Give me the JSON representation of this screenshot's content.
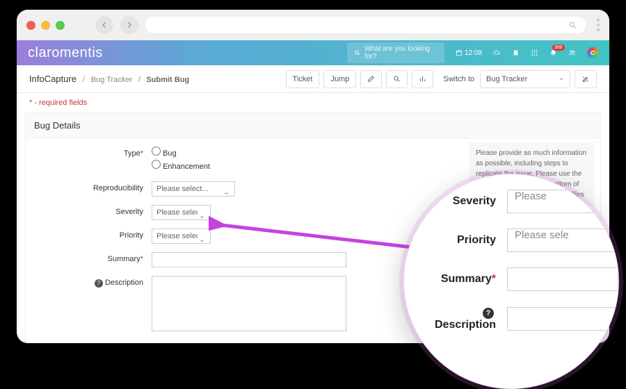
{
  "chrome": {
    "dot_colors": [
      "#ec5f57",
      "#f6bd3b",
      "#5dc94e"
    ]
  },
  "header": {
    "brand": "claromentis",
    "search_placeholder": "What are you looking for?",
    "time": "12:08",
    "badge": "368"
  },
  "breadcrumb": {
    "root": "InfoCapture",
    "mid": "Bug Tracker",
    "leaf": "Submit Bug",
    "ticket": "Ticket",
    "jump": "Jump",
    "switch": "Switch to",
    "switch_value": "Bug Tracker"
  },
  "required_note": "* - required fields",
  "panel": {
    "title": "Bug Details",
    "tip": "Please provide as much information as possible, including steps to replicate the issue. Please use the file upload facility at the bottom of the form to attach any relevant files"
  },
  "form": {
    "type_label": "Type",
    "type_opts": [
      "Bug",
      "Enhancement"
    ],
    "repro_label": "Reproducibility",
    "severity_label": "Severity",
    "priority_label": "Priority",
    "summary_label": "Summary",
    "description_label": "Description",
    "please_select": "Please select..."
  },
  "zoom": {
    "severity": "Severity",
    "priority": "Priority",
    "summary": "Summary",
    "description": "Description",
    "please": "Please",
    "please_sel": "Please sele"
  }
}
